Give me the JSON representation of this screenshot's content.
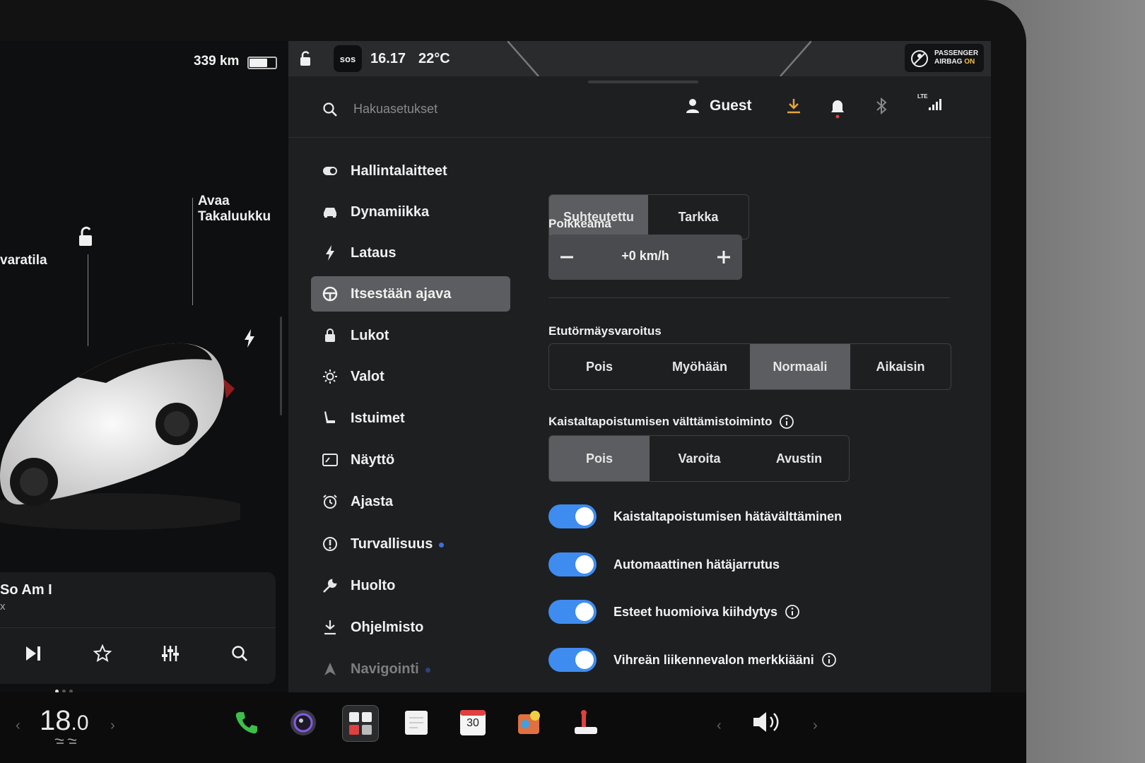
{
  "car": {
    "range": "339 km",
    "battery_level": 0.7,
    "label_trunk_line1": "Avaa",
    "label_trunk_line2": "Takaluukku",
    "label_frunk": "varatila"
  },
  "media": {
    "song_title": "So Am I",
    "artist": "x"
  },
  "statusbar": {
    "sos": "sos",
    "time": "16.17",
    "temperature": "22°C",
    "airbag_line1": "PASSENGER",
    "airbag_line2": "AIRBAG",
    "airbag_state": "ON"
  },
  "header": {
    "search_placeholder": "Hakuasetukset",
    "profile": "Guest"
  },
  "sidebar": {
    "items": [
      {
        "label": "Hallintalaitteet",
        "icon": "toggle-icon"
      },
      {
        "label": "Dynamiikka",
        "icon": "car-icon"
      },
      {
        "label": "Lataus",
        "icon": "bolt-icon"
      },
      {
        "label": "Itsestään ajava",
        "icon": "steering-wheel-icon"
      },
      {
        "label": "Lukot",
        "icon": "lock-icon"
      },
      {
        "label": "Valot",
        "icon": "sun-icon"
      },
      {
        "label": "Istuimet",
        "icon": "seat-icon"
      },
      {
        "label": "Näyttö",
        "icon": "display-icon"
      },
      {
        "label": "Ajasta",
        "icon": "alarm-icon"
      },
      {
        "label": "Turvallisuus",
        "icon": "alert-icon"
      },
      {
        "label": "Huolto",
        "icon": "wrench-icon"
      },
      {
        "label": "Ohjelmisto",
        "icon": "download-icon"
      },
      {
        "label": "Navigointi",
        "icon": "navigation-icon"
      }
    ],
    "active_index": 3
  },
  "content": {
    "speed_mode": {
      "options": [
        "Suhteutettu",
        "Tarkka"
      ],
      "selected": "Suhteutettu"
    },
    "offset": {
      "label": "Poikkeama",
      "value": "+0 km/h"
    },
    "fcw": {
      "label": "Etutörmäysvaroitus",
      "options": [
        "Pois",
        "Myöhään",
        "Normaali",
        "Aikaisin"
      ],
      "selected": "Normaali"
    },
    "lane": {
      "label": "Kaistaltapoistumisen välttämistoiminto",
      "options": [
        "Pois",
        "Varoita",
        "Avustin"
      ],
      "selected": "Pois"
    },
    "toggles": [
      {
        "label": "Kaistaltapoistumisen hätävälttäminen",
        "on": true
      },
      {
        "label": "Automaattinen hätäjarrutus",
        "on": true
      },
      {
        "label": "Esteet huomioiva kiihdytys",
        "on": true
      },
      {
        "label": "Vihreän liikennevalon merkkiääni",
        "on": true
      }
    ]
  },
  "dock": {
    "cabin_temp_int": "18",
    "cabin_temp_dec": ".0",
    "calendar_day": "30"
  },
  "colors": {
    "accent": "#3e8cf0",
    "selected_segment": "#5c5d60",
    "notification_dot": "#3e6ee0"
  }
}
